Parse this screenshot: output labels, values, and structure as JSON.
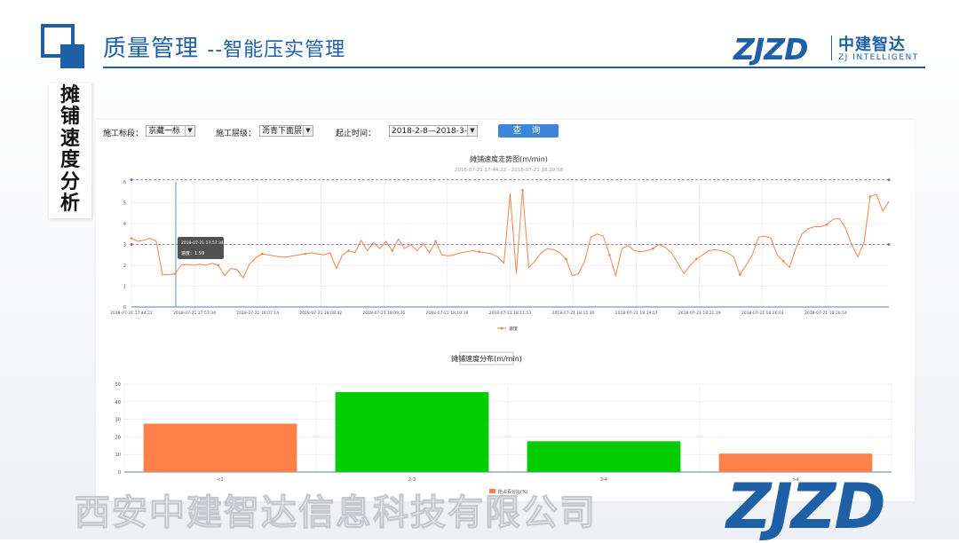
{
  "header": {
    "title": "质量管理",
    "subtitle": "--智能压实管理",
    "brand_mark": "ZJZD",
    "brand_cn": "中建智达",
    "brand_en": "ZJ INTELLIGENT",
    "color": "#1f5fa6"
  },
  "side_label": [
    "摊",
    "铺",
    "速",
    "度",
    "分",
    "析"
  ],
  "filters": {
    "section_label": "施工标段：",
    "section_value": "京藏一标",
    "layer_label": "施工层级：",
    "layer_value": "沥青下面层",
    "time_label": "起止时间：",
    "time_value": "2018-2-8—2018-3-5",
    "query_label": "查 询"
  },
  "line_chart": {
    "title": "摊铺速度走势图(m/min)",
    "subtitle": "2018-07-21 17:44:22 - 2018-07-21 18:29:58",
    "legend": "速度",
    "tooltip_time": "2018-07-21 17:57:34",
    "tooltip_value": "速度：1.59"
  },
  "bar_chart": {
    "title": "摊铺速度分布(m/min)",
    "legend": "所占百分比(%)"
  },
  "footer": {
    "company": "西安中建智达信息科技有限公司",
    "mark": "ZJZD"
  },
  "chart_data": [
    {
      "type": "line",
      "title": "摊铺速度走势图(m/min)",
      "subtitle": "2018-07-21 17:44:22 - 2018-07-21 18:29:58",
      "x_tick_labels": [
        "2018-07-21 17:44:22",
        "2018-07-21 17:57:34",
        "2018-07-21 18:07:14",
        "2018-07-21 18:08:42",
        "2018-07-21 18:09:26",
        "2018-07-21 18:10:19",
        "2018-07-21 18:11:53",
        "2018-07-21 18:15:10",
        "2018-07-21 18:19:07",
        "2018-07-21 18:21:19",
        "2018-07-21 18:26:01",
        "2018-07-21 18:26:54"
      ],
      "ylim": [
        0,
        6
      ],
      "y_ticks": [
        0,
        1,
        2,
        3,
        4,
        5,
        6
      ],
      "grid": true,
      "legend_position": "bottom",
      "series": [
        {
          "name": "速度",
          "color": "#f5834d",
          "values": [
            3.3,
            3.15,
            3.2,
            3.3,
            3.15,
            1.55,
            1.55,
            1.59,
            2.0,
            2.05,
            2.0,
            2.05,
            2.0,
            2.1,
            2.0,
            1.5,
            1.85,
            1.8,
            1.4,
            2.05,
            2.35,
            2.55,
            2.5,
            2.45,
            2.4,
            2.4,
            2.45,
            2.5,
            2.55,
            2.6,
            2.55,
            2.5,
            2.6,
            1.85,
            2.5,
            2.7,
            2.6,
            3.2,
            2.7,
            3.1,
            2.8,
            3.15,
            2.7,
            3.25,
            2.8,
            3.0,
            2.7,
            3.05,
            2.6,
            3.15,
            2.5,
            2.45,
            2.5,
            2.6,
            2.65,
            2.7,
            2.65,
            2.6,
            2.55,
            2.4,
            2.1,
            5.45,
            1.6,
            5.6,
            1.9,
            2.2,
            2.6,
            2.8,
            2.75,
            2.6,
            2.3,
            1.5,
            1.6,
            2.2,
            3.35,
            3.5,
            3.4,
            2.5,
            1.5,
            2.8,
            2.95,
            2.7,
            2.65,
            2.7,
            2.8,
            3.0,
            2.85,
            2.6,
            2.1,
            1.6,
            2.0,
            2.3,
            2.5,
            2.7,
            2.75,
            2.7,
            2.6,
            2.4,
            1.55,
            2.0,
            2.5,
            3.35,
            3.4,
            3.3,
            2.5,
            2.2,
            1.9,
            2.8,
            3.5,
            3.75,
            3.85,
            3.85,
            3.95,
            4.2,
            4.25,
            3.8,
            3.0,
            2.4,
            3.1,
            5.3,
            5.4,
            4.6,
            5.05
          ]
        }
      ],
      "reference_lines": [
        6.1,
        3.0
      ]
    },
    {
      "type": "bar",
      "title": "摊铺速度分布(m/min)",
      "categories": [
        "<2",
        "2-3",
        "3-4",
        ">4"
      ],
      "ylim": [
        0,
        50
      ],
      "y_ticks": [
        0,
        10,
        20,
        30,
        40,
        50
      ],
      "grid": true,
      "legend_position": "bottom",
      "series": [
        {
          "name": "所占百分比(%)",
          "values": [
            27.5,
            45.5,
            17.5,
            10.5
          ],
          "colors": [
            "#ff8149",
            "#00cc00",
            "#00cc00",
            "#ff8149"
          ]
        }
      ]
    }
  ]
}
